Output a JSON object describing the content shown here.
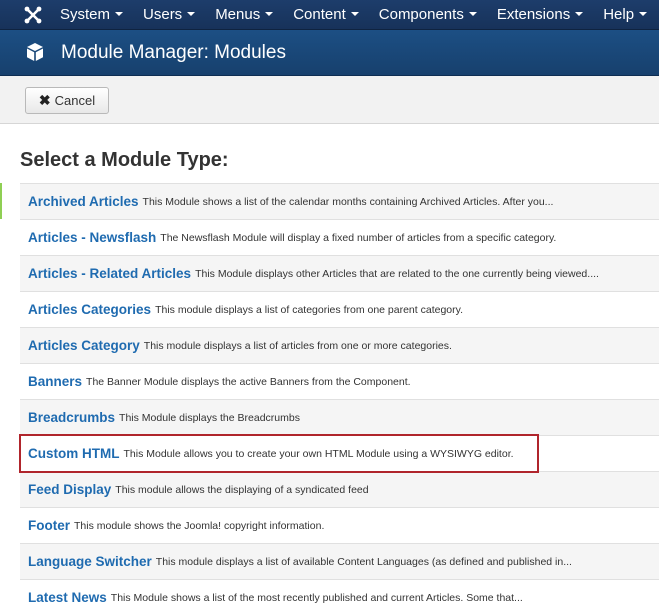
{
  "topnav": {
    "items": [
      {
        "label": "System"
      },
      {
        "label": "Users"
      },
      {
        "label": "Menus"
      },
      {
        "label": "Content"
      },
      {
        "label": "Components"
      },
      {
        "label": "Extensions"
      },
      {
        "label": "Help"
      }
    ]
  },
  "header": {
    "title": "Module Manager: Modules"
  },
  "toolbar": {
    "cancel_label": "Cancel"
  },
  "main": {
    "heading": "Select a Module Type:",
    "modules": [
      {
        "name": "Archived Articles",
        "desc": "This Module shows a list of the calendar months containing Archived Articles. After you..."
      },
      {
        "name": "Articles - Newsflash",
        "desc": "The Newsflash Module will display a fixed number of articles from a specific category."
      },
      {
        "name": "Articles - Related Articles",
        "desc": "This Module displays other Articles that are related to the one currently being viewed...."
      },
      {
        "name": "Articles Categories",
        "desc": "This module displays a list of categories from one parent category."
      },
      {
        "name": "Articles Category",
        "desc": "This module displays a list of articles from one or more categories."
      },
      {
        "name": "Banners",
        "desc": "The Banner Module displays the active Banners from the Component."
      },
      {
        "name": "Breadcrumbs",
        "desc": "This Module displays the Breadcrumbs"
      },
      {
        "name": "Custom HTML",
        "desc": "This Module allows you to create your own HTML Module using a WYSIWYG editor."
      },
      {
        "name": "Feed Display",
        "desc": "This module allows the displaying of a syndicated feed"
      },
      {
        "name": "Footer",
        "desc": "This module shows the Joomla! copyright information."
      },
      {
        "name": "Language Switcher",
        "desc": "This module displays a list of available Content Languages (as defined and published in..."
      },
      {
        "name": "Latest News",
        "desc": "This Module shows a list of the most recently published and current Articles. Some that..."
      }
    ],
    "highlighted_module": "Custom HTML"
  },
  "colors": {
    "link": "#1f6bb0",
    "highlight_border": "#b0252c",
    "nav_bg": "#1d3d6b",
    "header_bg": "#1c4f84"
  },
  "icons": {
    "logo": "joomla-logo-icon",
    "header": "cube-icon",
    "cancel": "close-icon"
  }
}
